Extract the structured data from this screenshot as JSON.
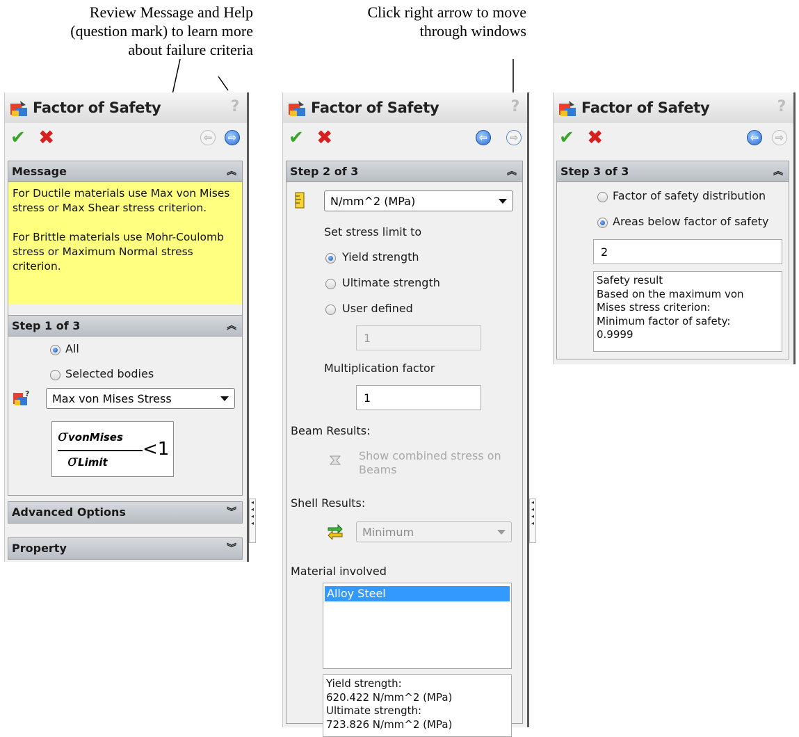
{
  "annotations": {
    "left_lines": [
      "Review Message and Help",
      "(question mark) to learn more",
      "about failure criteria"
    ],
    "right_lines": [
      "Click right arrow to move",
      "through windows"
    ]
  },
  "panel1": {
    "title": "Factor of Safety",
    "help": "?",
    "message": {
      "header": "Message",
      "para1": "For Ductile materials use Max von Mises stress or Max Shear stress criterion.",
      "para2": "For Brittle materials use Mohr-Coulomb stress or Maximum Normal stress criterion."
    },
    "step": {
      "header": "Step 1 of 3",
      "radio_all": "All",
      "radio_selected": "Selected bodies",
      "criterion": "Max von Mises Stress",
      "formula": {
        "sigma": "σ",
        "num_sub": "vonMises",
        "den_sub": "Limit",
        "rhs": "<1"
      }
    },
    "advanced": "Advanced Options",
    "property": "Property"
  },
  "panel2": {
    "title": "Factor of Safety",
    "help": "?",
    "step": {
      "header": "Step 2 of 3",
      "units": "N/mm^2 (MPa)",
      "set_limit_label": "Set stress limit to",
      "radio_yield": "Yield strength",
      "radio_ultimate": "Ultimate strength",
      "radio_user": "User defined",
      "user_value": "1",
      "mult_label": "Multiplication factor",
      "mult_value": "1",
      "beam_label": "Beam Results:",
      "beam_option_line1": "Show combined stress on",
      "beam_option_line2": "Beams",
      "shell_label": "Shell Results:",
      "shell_value": "Minimum",
      "material_label": "Material involved",
      "material_selected": "Alloy Steel",
      "strength_lines": [
        "Yield strength:",
        "620.422 N/mm^2 (MPa)",
        "Ultimate strength:",
        "723.826 N/mm^2 (MPa)"
      ]
    }
  },
  "panel3": {
    "title": "Factor of Safety",
    "help": "?",
    "step": {
      "header": "Step 3 of 3",
      "radio_distribution": "Factor of safety distribution",
      "radio_areas": "Areas below factor of safety",
      "fos_value": "2",
      "result_lines": [
        "Safety result",
        "Based on the maximum von",
        "Mises stress criterion:",
        "Minimum factor of safety:",
        "0.9999"
      ]
    }
  },
  "icons": {
    "ok": "checkmark-icon",
    "cancel": "x-icon",
    "back": "back-arrow-icon",
    "next": "next-arrow-icon",
    "collapse": "double-chevron-up-icon",
    "expand": "double-chevron-down-icon"
  },
  "colors": {
    "message_bg": "#ffff80",
    "ok_green": "#3aa52b",
    "cancel_red": "#d62020",
    "selection_blue": "#3399ff"
  }
}
